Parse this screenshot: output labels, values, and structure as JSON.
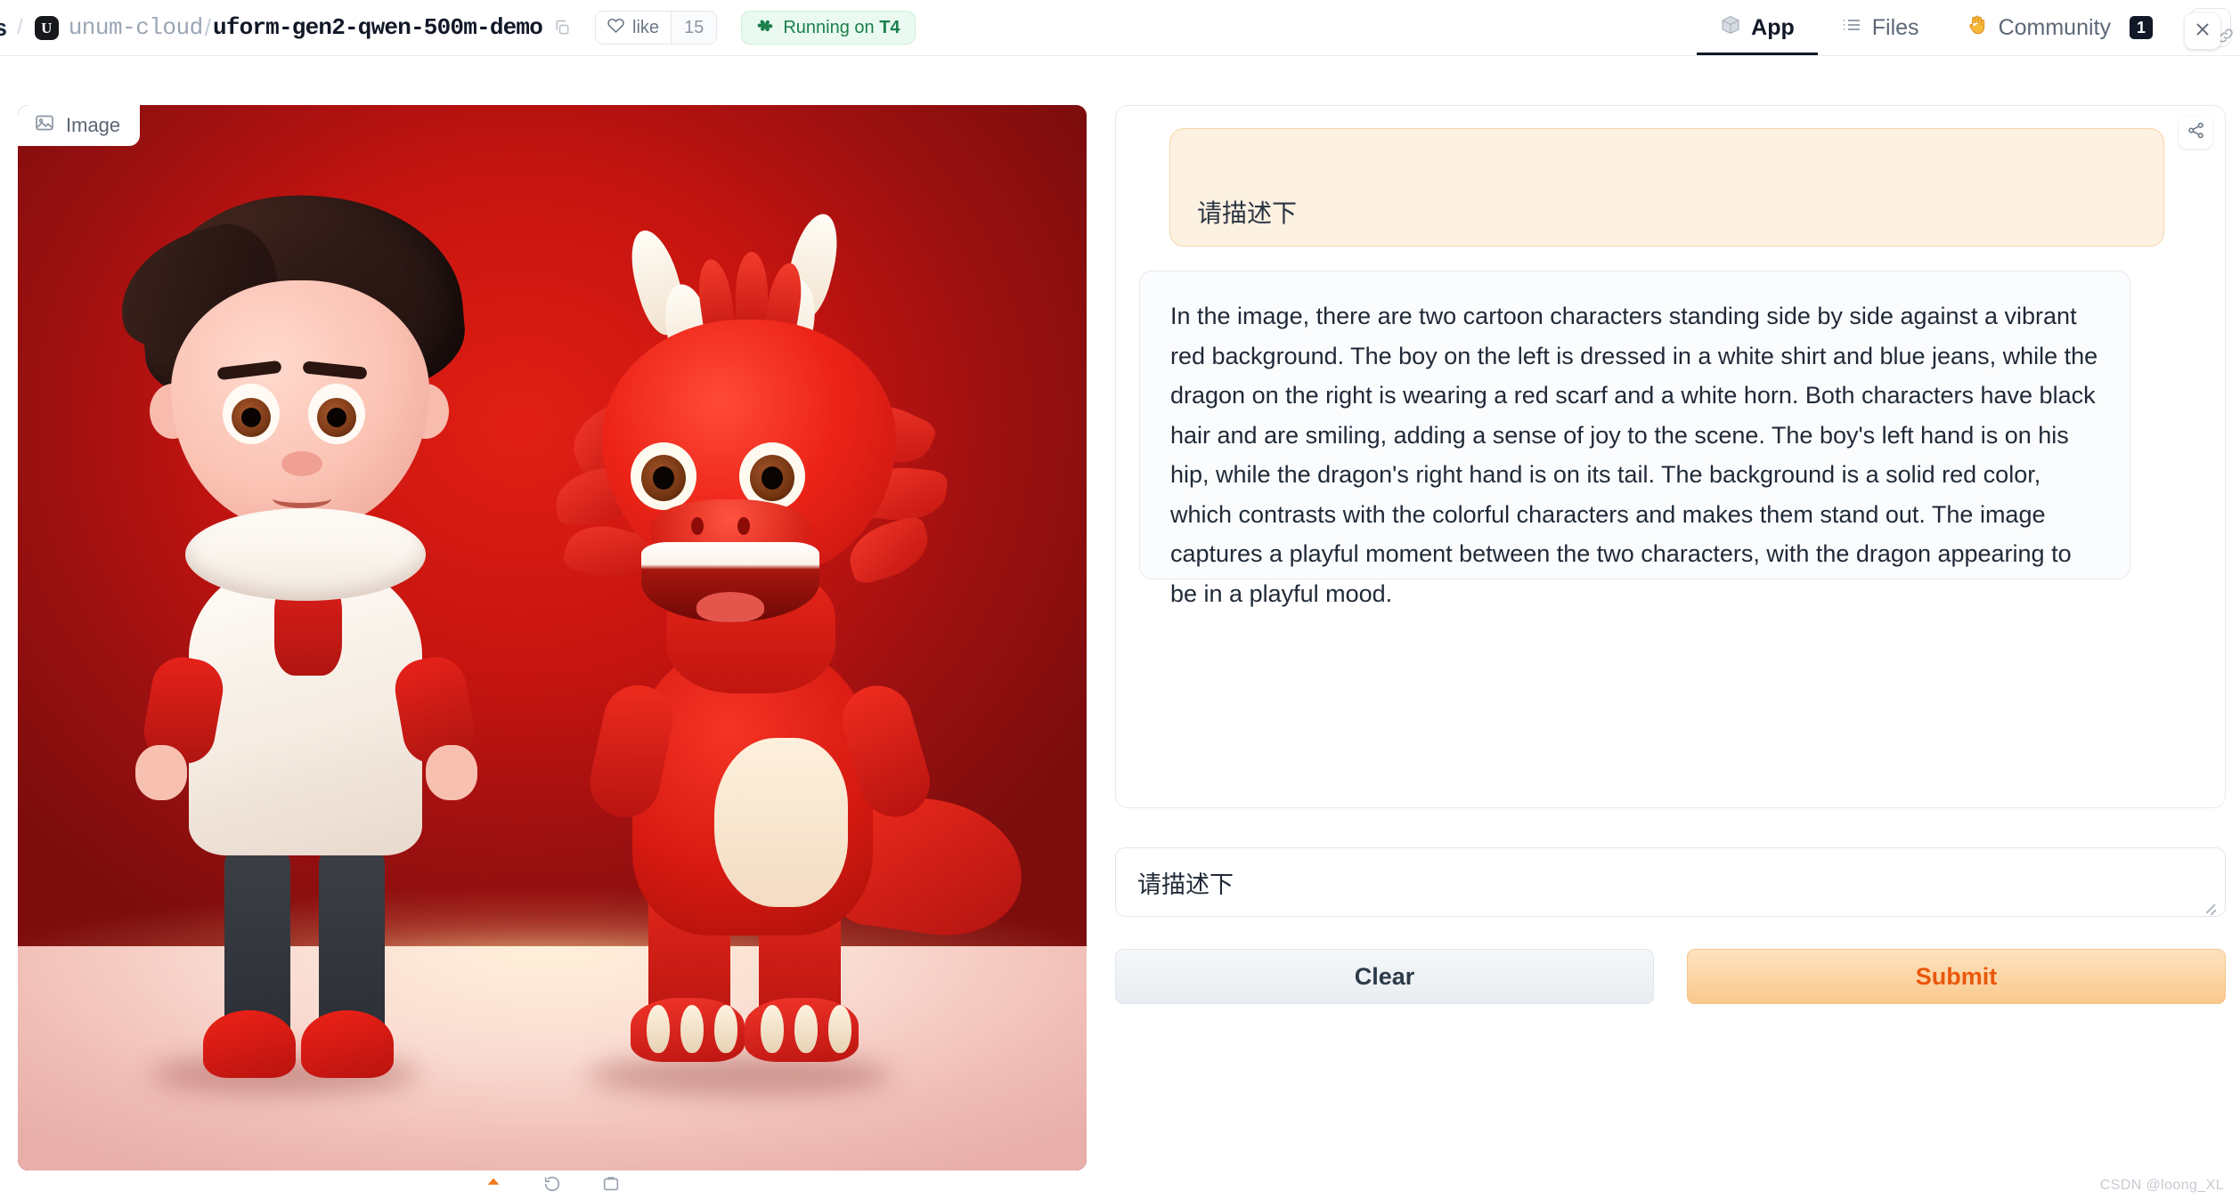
{
  "header": {
    "partial_text": "s",
    "org_logo_letter": "U",
    "org": "unum-cloud",
    "separator": "/",
    "repo": "uform-gen2-qwen-500m-demo",
    "copy_icon": "copy-icon",
    "like_label": "like",
    "like_icon": "heart-icon",
    "like_count": "15",
    "status_icon": "fan-icon",
    "status_prefix": "Running on ",
    "status_hardware": "T4",
    "tabs": [
      {
        "label": "App",
        "icon": "cube-icon",
        "active": true
      },
      {
        "label": "Files",
        "icon": "files-icon",
        "active": false
      },
      {
        "label": "Community",
        "icon": "wave-hand-icon",
        "active": false,
        "badge": "1"
      }
    ],
    "kebab_icon": "three-dots-icon",
    "link_icon": "link-icon"
  },
  "image_panel": {
    "tab_label": "Image",
    "tab_icon": "image-icon",
    "close_icon": "close-icon",
    "toolbar_icons": [
      "upload-icon",
      "undo-icon",
      "clipboard-icon"
    ],
    "scene": {
      "background_color": "#c71410",
      "floor_color": "#f3cec6",
      "characters": [
        "boy",
        "dragon"
      ]
    }
  },
  "output": {
    "share_icon": "share-icon",
    "prompt": "请描述下",
    "answer": "In the image, there are two cartoon characters standing side by side against a vibrant red background. The boy on the left is dressed in a white shirt and blue jeans, while the dragon on the right is wearing a red scarf and a white horn. Both characters have black hair and are smiling, adding a sense of joy to the scene. The boy's left hand is on his hip, while the dragon's right hand is on its tail. The background is a solid red color, which contrasts with the colorful characters and makes them stand out. The image captures a playful moment between the two characters, with the dragon appearing to be in a playful mood."
  },
  "input": {
    "value": "请描述下",
    "placeholder": "请描述下"
  },
  "actions": {
    "clear_label": "Clear",
    "submit_label": "Submit"
  },
  "watermark": "CSDN @loong_XL",
  "colors": {
    "accent_orange": "#ea580c",
    "submit_bg": "#fac98d",
    "prompt_bubble_bg": "#fdf1e1",
    "running_green": "#1a7f4b",
    "scene_red": "#c71410"
  }
}
